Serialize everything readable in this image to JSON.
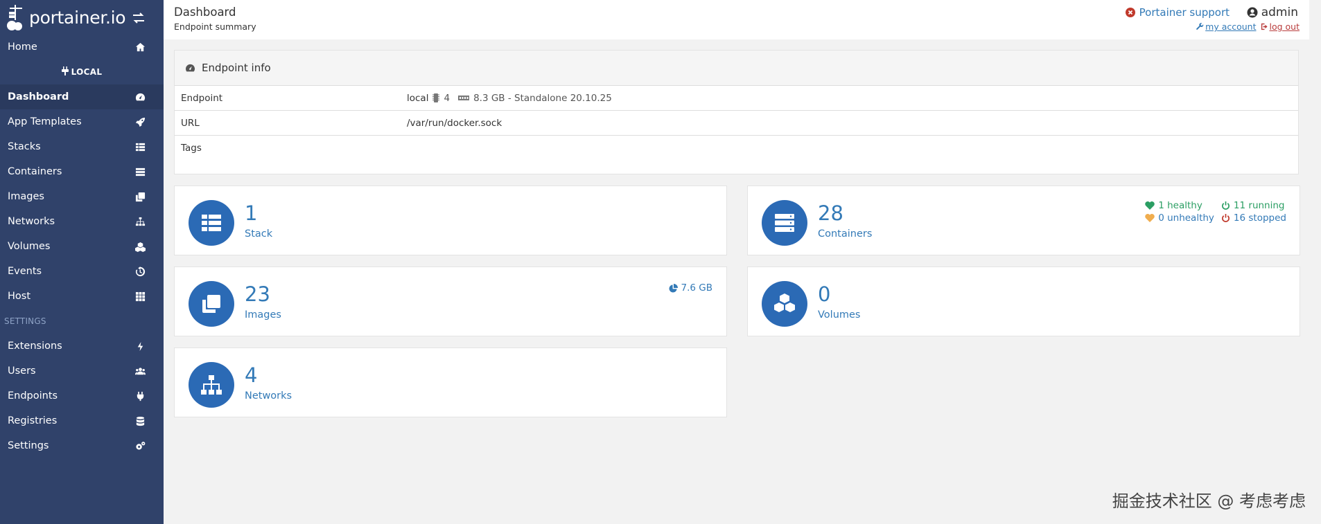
{
  "brand": {
    "name": "portainer.io"
  },
  "sidebar": {
    "items_top": [
      {
        "label": "Home",
        "icon": "home-icon"
      }
    ],
    "endpoint_label": "LOCAL",
    "items_endpoint": [
      {
        "label": "Dashboard",
        "icon": "tachometer-icon",
        "active": true
      },
      {
        "label": "App Templates",
        "icon": "rocket-icon"
      },
      {
        "label": "Stacks",
        "icon": "th-list-icon"
      },
      {
        "label": "Containers",
        "icon": "server-icon"
      },
      {
        "label": "Images",
        "icon": "clone-icon"
      },
      {
        "label": "Networks",
        "icon": "sitemap-icon"
      },
      {
        "label": "Volumes",
        "icon": "cubes-icon"
      },
      {
        "label": "Events",
        "icon": "history-icon"
      },
      {
        "label": "Host",
        "icon": "th-icon"
      }
    ],
    "section_settings": "SETTINGS",
    "items_settings": [
      {
        "label": "Extensions",
        "icon": "bolt-icon"
      },
      {
        "label": "Users",
        "icon": "users-icon"
      },
      {
        "label": "Endpoints",
        "icon": "plug-icon"
      },
      {
        "label": "Registries",
        "icon": "database-icon"
      },
      {
        "label": "Settings",
        "icon": "cogs-icon"
      }
    ]
  },
  "header": {
    "title": "Dashboard",
    "subtitle": "Endpoint summary",
    "support": "Portainer support",
    "user": "admin",
    "my_account": "my account",
    "log_out": "log out"
  },
  "endpoint_info": {
    "title": "Endpoint info",
    "rows": {
      "endpoint_key": "Endpoint",
      "endpoint_name": "local",
      "cpu": "4",
      "memory_desc": "8.3 GB - Standalone 20.10.25",
      "url_key": "URL",
      "url_value": "/var/run/docker.sock",
      "tags_key": "Tags"
    }
  },
  "widgets": {
    "stacks": {
      "count": "1",
      "label": "Stack"
    },
    "containers": {
      "count": "28",
      "label": "Containers",
      "healthy": "1 healthy",
      "running": "11 running",
      "unhealthy": "0 unhealthy",
      "stopped": "16 stopped"
    },
    "images": {
      "count": "23",
      "label": "Images",
      "size": "7.6 GB"
    },
    "volumes": {
      "count": "0",
      "label": "Volumes"
    },
    "networks": {
      "count": "4",
      "label": "Networks"
    }
  },
  "watermark": "掘金技术社区 @ 考虑考虑",
  "colors": {
    "sidebar": "#30426a",
    "accent": "#337ab7",
    "widget_icon": "#2b6ab5"
  }
}
